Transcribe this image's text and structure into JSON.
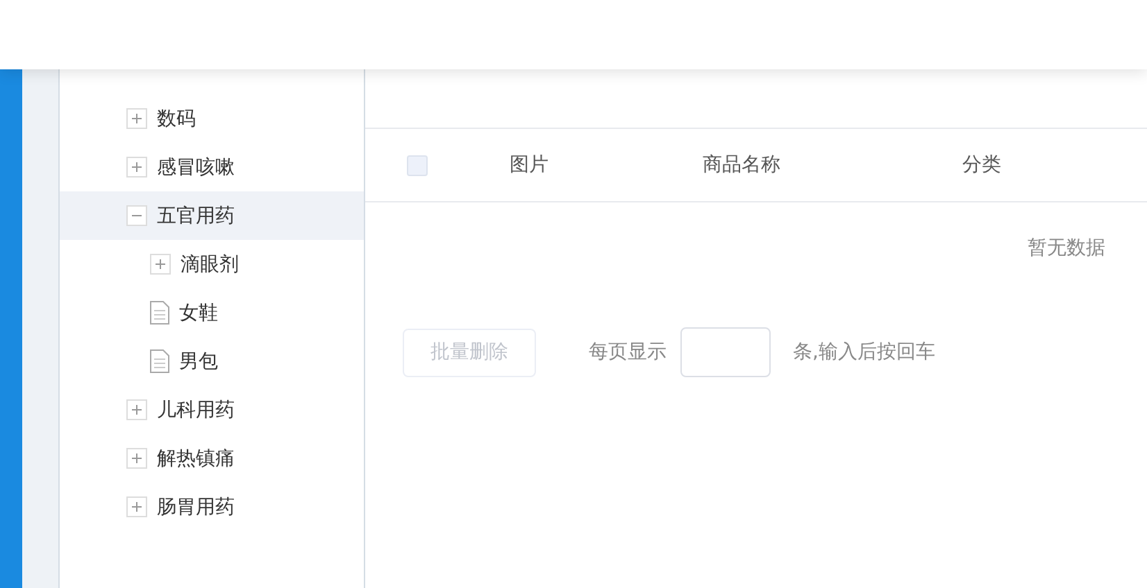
{
  "tree": {
    "children": [
      {
        "label": "数码",
        "kind": "folder",
        "expanded": false,
        "selected": false
      },
      {
        "label": "感冒咳嗽",
        "kind": "folder",
        "expanded": false,
        "selected": false
      },
      {
        "label": "五官用药",
        "kind": "folder",
        "expanded": true,
        "selected": true,
        "children": [
          {
            "label": "滴眼剂",
            "kind": "folder",
            "expanded": false,
            "selected": false
          },
          {
            "label": "女鞋",
            "kind": "file",
            "selected": false
          },
          {
            "label": "男包",
            "kind": "file",
            "selected": false
          }
        ]
      },
      {
        "label": "儿科用药",
        "kind": "folder",
        "expanded": false,
        "selected": false
      },
      {
        "label": "解热镇痛",
        "kind": "folder",
        "expanded": false,
        "selected": false
      },
      {
        "label": "肠胃用药",
        "kind": "folder",
        "expanded": false,
        "selected": false
      }
    ]
  },
  "table": {
    "select_all_checked": false,
    "columns": [
      "图片",
      "商品名称",
      "分类"
    ],
    "empty_text": "暂无数据"
  },
  "footer": {
    "batch_delete": {
      "label": "批量删除",
      "disabled": true
    },
    "page_size_label": "每页显示",
    "page_size_hint": "条,输入后按回车"
  }
}
